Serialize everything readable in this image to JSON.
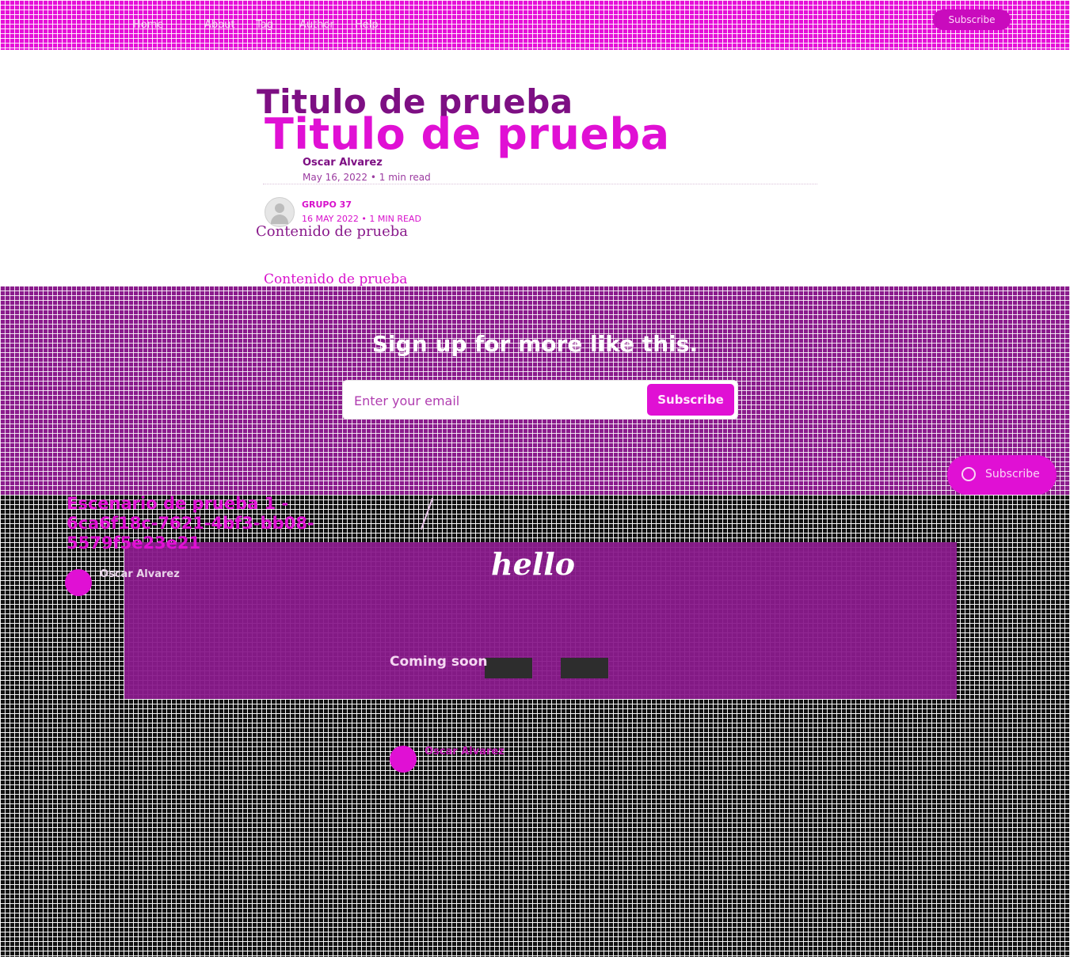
{
  "colors": {
    "header_bg": "#e60fd8",
    "signup_bg": "#8a1b8c",
    "footer_bg": "#111111",
    "accent": "#e010d4"
  },
  "header": {
    "nav": [
      "Home",
      "About",
      "Tag",
      "Author",
      "Help"
    ],
    "subscribe_label": "Subscribe"
  },
  "article": {
    "title": "Titulo de prueba",
    "title_duplicate": "Titulo de prueba",
    "author": "Oscar Alvarez",
    "date": "May 16, 2022",
    "read_time": "1 min read",
    "separator": "•",
    "author_alt": "GRUPO 37",
    "date_alt": "16 MAY 2022",
    "read_time_alt": "1 MIN READ",
    "content": "Contenido de prueba",
    "content_duplicate": "Contenido de prueba"
  },
  "signup": {
    "title": "Sign up for more like this.",
    "email_placeholder": "Enter your email",
    "button": "Subscribe"
  },
  "floating_subscribe": {
    "label": "Subscribe",
    "icon": "subscribe-icon"
  },
  "related": {
    "post_title": "Escenario de prueba 1 - 6ca6f18c-7621-4bf3-bb08-5579f5e23e21",
    "author": "Oscar Alvarez",
    "feature_heading": "hello",
    "coming_soon": "Coming soon",
    "second_author": "Oscar Alvarez"
  }
}
